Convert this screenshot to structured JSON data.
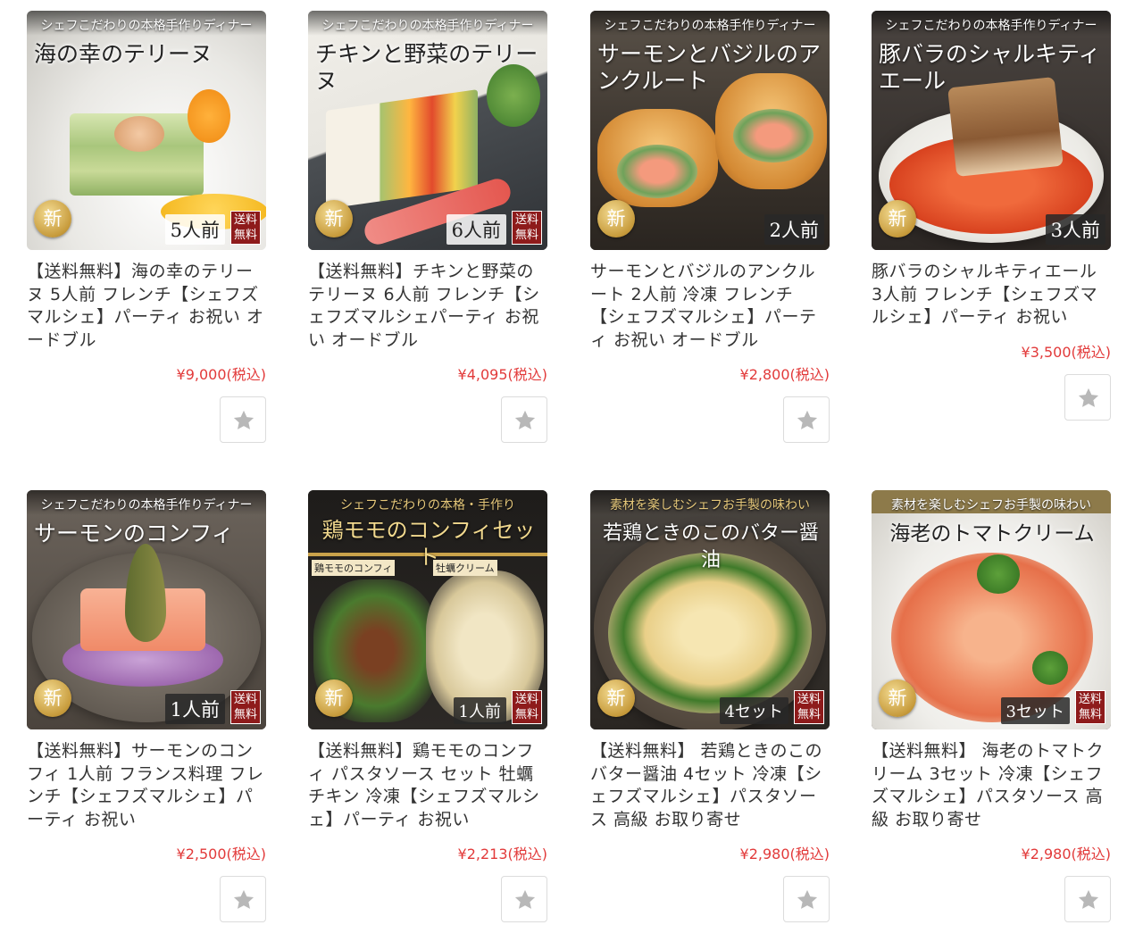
{
  "products": [
    {
      "tagline": "シェフこだわりの本格手作りディナー",
      "image_title": "海の幸のテリーヌ",
      "new_badge": "新",
      "servings": "5人前",
      "free_ship": "送料無料",
      "name": "【送料無料】海の幸のテリーヌ 5人前 フレンチ【シェフズマルシェ】パーティ お祝い オードブル",
      "price": "¥9,000(税込)"
    },
    {
      "tagline": "シェフこだわりの本格手作りディナー",
      "image_title": "チキンと野菜のテリーヌ",
      "new_badge": "新",
      "servings": "6人前",
      "free_ship": "送料無料",
      "name": "【送料無料】チキンと野菜のテリーヌ 6人前 フレンチ【シェフズマルシェパーティ お祝い オードブル",
      "price": "¥4,095(税込)"
    },
    {
      "tagline": "シェフこだわりの本格手作りディナー",
      "image_title": "サーモンとバジルのアンクルート",
      "new_badge": "新",
      "servings": "2人前",
      "name": "サーモンとバジルのアンクルート 2人前 冷凍 フレンチ 【シェフズマルシェ】パーティ お祝い オードブル",
      "price": "¥2,800(税込)"
    },
    {
      "tagline": "シェフこだわりの本格手作りディナー",
      "image_title": "豚バラのシャルキティエール",
      "new_badge": "新",
      "servings": "3人前",
      "name": "豚バラのシャルキティエール 3人前 フレンチ【シェフズマルシェ】パーティ お祝い",
      "price": "¥3,500(税込)"
    },
    {
      "tagline": "シェフこだわりの本格手作りディナー",
      "image_title": "サーモンのコンフィ",
      "new_badge": "新",
      "servings": "1人前",
      "free_ship": "送料無料",
      "name": "【送料無料】サーモンのコンフィ 1人前 フランス料理 フレンチ【シェフズマルシェ】パーティ お祝い",
      "price": "¥2,500(税込)"
    },
    {
      "tagline": "シェフこだわりの本格・手作り",
      "image_title": "鶏モモのコンフィセット",
      "sub_label_1": "鶏モモのコンフィ",
      "sub_label_2": "牡蠣クリーム",
      "new_badge": "新",
      "servings": "1人前",
      "free_ship": "送料無料",
      "name": "【送料無料】鶏モモのコンフィ パスタソース セット 牡蠣 チキン 冷凍【シェフズマルシェ】パーティ お祝い",
      "price": "¥2,213(税込)"
    },
    {
      "tagline": "素材を楽しむシェフお手製の味わい",
      "image_title": "若鶏ときのこのバター醤油",
      "new_badge": "新",
      "servings": "4セット",
      "free_ship": "送料無料",
      "name": "【送料無料】 若鶏ときのこのバター醤油 4セット 冷凍【シェフズマルシェ】パスタソース 高級 お取り寄せ",
      "price": "¥2,980(税込)"
    },
    {
      "tagline": "素材を楽しむシェフお手製の味わい",
      "image_title": "海老のトマトクリーム",
      "new_badge": "新",
      "servings": "3セット",
      "free_ship": "送料無料",
      "name": "【送料無料】 海老のトマトクリーム 3セット 冷凍【シェフズマルシェ】パスタソース 高級 お取り寄せ",
      "price": "¥2,980(税込)"
    }
  ],
  "icons": {
    "favorite": "star-icon"
  },
  "colors": {
    "price": "#e23a3a",
    "new_badge": "#c79b3c",
    "free_ship": "#8e1b1b"
  }
}
